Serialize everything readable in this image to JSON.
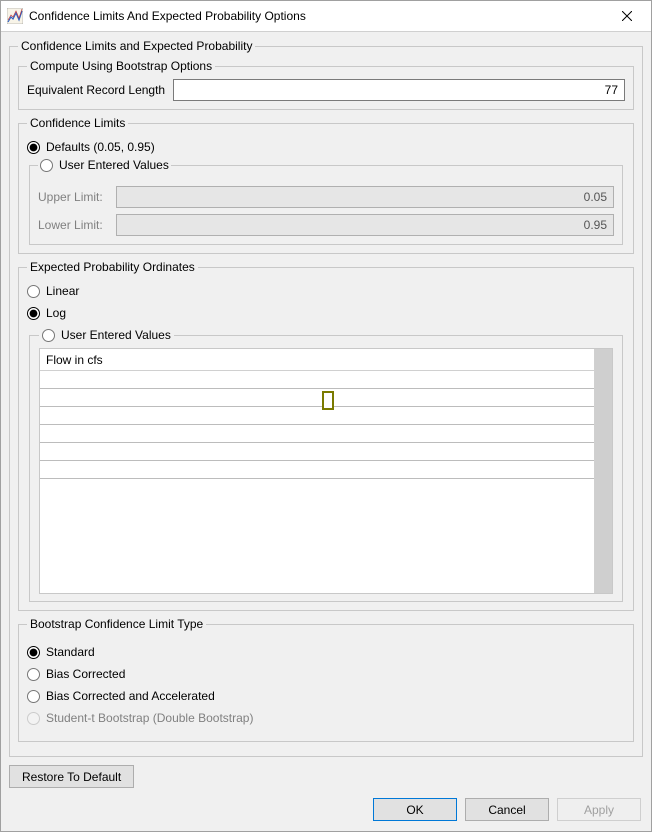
{
  "window": {
    "title": "Confidence Limits And Expected Probability Options"
  },
  "outer": {
    "legend": "Confidence Limits and Expected Probability"
  },
  "bootstrap_opts": {
    "legend": "Compute Using Bootstrap Options",
    "record_length_label": "Equivalent Record Length",
    "record_length_value": "77"
  },
  "conf_limits": {
    "legend": "Confidence Limits",
    "defaults_label": "Defaults (0.05, 0.95)",
    "user_label": "User Entered Values",
    "upper_label": "Upper Limit:",
    "upper_value": "0.05",
    "lower_label": "Lower Limit:",
    "lower_value": "0.95",
    "selected": "defaults"
  },
  "epo": {
    "legend": "Expected Probability Ordinates",
    "linear_label": "Linear",
    "log_label": "Log",
    "user_label": "User Entered Values",
    "selected": "log",
    "table_header": "Flow in cfs"
  },
  "bclt": {
    "legend": "Bootstrap Confidence Limit Type",
    "standard_label": "Standard",
    "bias_label": "Bias Corrected",
    "biasacc_label": "Bias Corrected and Accelerated",
    "studentt_label": "Student-t Bootstrap (Double Bootstrap)",
    "selected": "standard",
    "studentt_enabled": false
  },
  "buttons": {
    "restore": "Restore To Default",
    "ok": "OK",
    "cancel": "Cancel",
    "apply": "Apply",
    "apply_enabled": false
  }
}
